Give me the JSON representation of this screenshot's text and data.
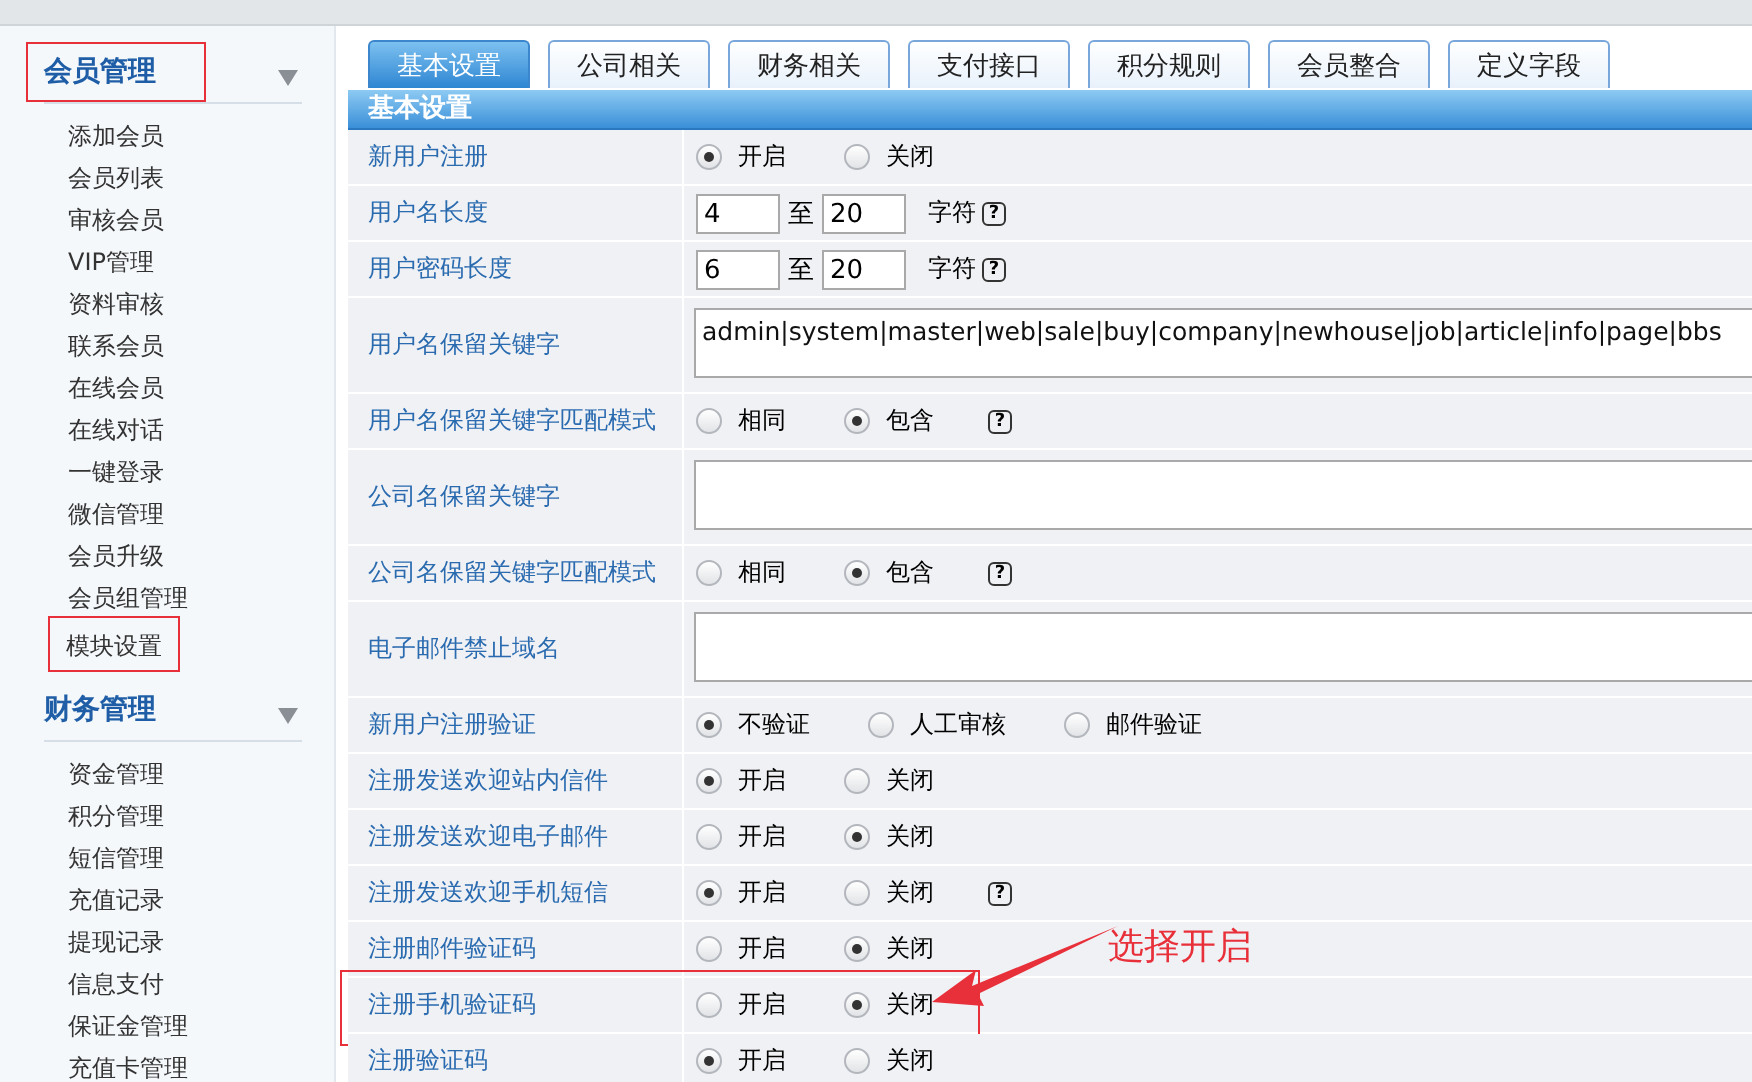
{
  "sidebar": {
    "groups": [
      {
        "title": "会员管理",
        "highlighted": true,
        "items": [
          {
            "label": "添加会员",
            "highlighted": false
          },
          {
            "label": "会员列表",
            "highlighted": false
          },
          {
            "label": "审核会员",
            "highlighted": false
          },
          {
            "label": "VIP管理",
            "highlighted": false
          },
          {
            "label": "资料审核",
            "highlighted": false
          },
          {
            "label": "联系会员",
            "highlighted": false
          },
          {
            "label": "在线会员",
            "highlighted": false
          },
          {
            "label": "在线对话",
            "highlighted": false
          },
          {
            "label": "一键登录",
            "highlighted": false
          },
          {
            "label": "微信管理",
            "highlighted": false
          },
          {
            "label": "会员升级",
            "highlighted": false
          },
          {
            "label": "会员组管理",
            "highlighted": false
          },
          {
            "label": "模块设置",
            "highlighted": true
          }
        ]
      },
      {
        "title": "财务管理",
        "highlighted": false,
        "items": [
          {
            "label": "资金管理",
            "highlighted": false
          },
          {
            "label": "积分管理",
            "highlighted": false
          },
          {
            "label": "短信管理",
            "highlighted": false
          },
          {
            "label": "充值记录",
            "highlighted": false
          },
          {
            "label": "提现记录",
            "highlighted": false
          },
          {
            "label": "信息支付",
            "highlighted": false
          },
          {
            "label": "保证金管理",
            "highlighted": false
          },
          {
            "label": "充值卡管理",
            "highlighted": false
          }
        ]
      }
    ]
  },
  "tabs": [
    {
      "label": "基本设置",
      "selected": true
    },
    {
      "label": "公司相关",
      "selected": false
    },
    {
      "label": "财务相关",
      "selected": false
    },
    {
      "label": "支付接口",
      "selected": false
    },
    {
      "label": "积分规则",
      "selected": false
    },
    {
      "label": "会员整合",
      "selected": false
    },
    {
      "label": "定义字段",
      "selected": false
    }
  ],
  "section_title": "基本设置",
  "rows": [
    {
      "label": "新用户注册",
      "kind": "radio",
      "highlighted": false,
      "options": [
        {
          "label": "开启",
          "selected": true
        },
        {
          "label": "关闭",
          "selected": false
        }
      ]
    },
    {
      "label": "用户名长度",
      "kind": "range",
      "highlighted": false,
      "min": "4",
      "separator": "至",
      "max": "20",
      "unit": "字符",
      "help": "?"
    },
    {
      "label": "用户密码长度",
      "kind": "range",
      "highlighted": false,
      "min": "6",
      "separator": "至",
      "max": "20",
      "unit": "字符",
      "help": "?"
    },
    {
      "label": "用户名保留关键字",
      "kind": "textarea",
      "highlighted": false,
      "value": "admin|system|master|web|sale|buy|company|newhouse|job|article|info|page|bbs"
    },
    {
      "label": "用户名保留关键字匹配模式",
      "kind": "radio",
      "highlighted": false,
      "options": [
        {
          "label": "相同",
          "selected": false
        },
        {
          "label": "包含",
          "selected": true
        }
      ],
      "help": "?"
    },
    {
      "label": "公司名保留关键字",
      "kind": "textarea",
      "highlighted": false
    },
    {
      "label": "公司名保留关键字匹配模式",
      "kind": "radio",
      "highlighted": false,
      "options": [
        {
          "label": "相同",
          "selected": false
        },
        {
          "label": "包含",
          "selected": true
        }
      ],
      "help": "?"
    },
    {
      "label": "电子邮件禁止域名",
      "kind": "textarea",
      "highlighted": false
    },
    {
      "label": "新用户注册验证",
      "kind": "radio",
      "highlighted": false,
      "options": [
        {
          "label": "不验证",
          "selected": true
        },
        {
          "label": "人工审核",
          "selected": false
        },
        {
          "label": "邮件验证",
          "selected": false
        }
      ]
    },
    {
      "label": "注册发送欢迎站内信件",
      "kind": "radio",
      "highlighted": false,
      "options": [
        {
          "label": "开启",
          "selected": true
        },
        {
          "label": "关闭",
          "selected": false
        }
      ]
    },
    {
      "label": "注册发送欢迎电子邮件",
      "kind": "radio",
      "highlighted": false,
      "options": [
        {
          "label": "开启",
          "selected": false
        },
        {
          "label": "关闭",
          "selected": true
        }
      ]
    },
    {
      "label": "注册发送欢迎手机短信",
      "kind": "radio",
      "highlighted": false,
      "options": [
        {
          "label": "开启",
          "selected": true
        },
        {
          "label": "关闭",
          "selected": false
        }
      ],
      "help": "?"
    },
    {
      "label": "注册邮件验证码",
      "kind": "radio",
      "highlighted": false,
      "options": [
        {
          "label": "开启",
          "selected": false
        },
        {
          "label": "关闭",
          "selected": true
        }
      ]
    },
    {
      "label": "注册手机验证码",
      "kind": "radio",
      "highlighted": true,
      "options": [
        {
          "label": "开启",
          "selected": false
        },
        {
          "label": "关闭",
          "selected": true
        }
      ],
      "callout": "选择开启"
    },
    {
      "label": "注册验证码",
      "kind": "radio",
      "highlighted": false,
      "options": [
        {
          "label": "开启",
          "selected": true
        },
        {
          "label": "关闭",
          "selected": false
        }
      ]
    }
  ]
}
